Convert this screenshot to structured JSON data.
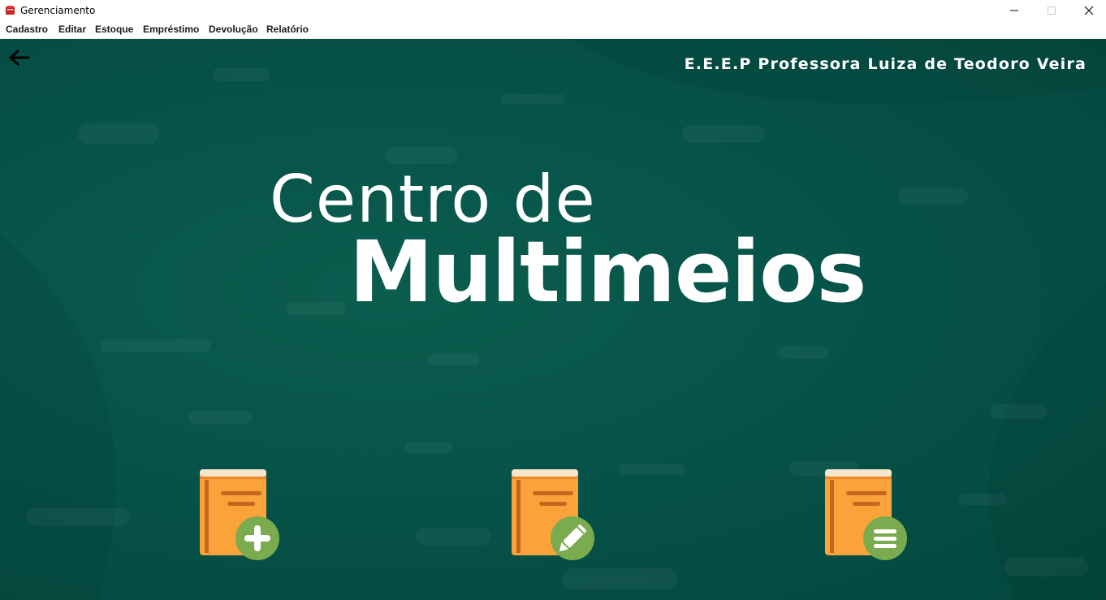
{
  "window": {
    "title": "Gerenciamento",
    "icon": "app-icon"
  },
  "menu": {
    "items": [
      {
        "label": "Cadastro"
      },
      {
        "label": "Editar"
      },
      {
        "label": "Estoque"
      },
      {
        "label": "Empréstimo"
      },
      {
        "label": "Devolução"
      },
      {
        "label": "Relatório"
      }
    ]
  },
  "header": {
    "school_name": "E.E.E.P Professora Luiza de Teodoro Veira"
  },
  "hero": {
    "line1": "Centro de",
    "line2": "Multimeios"
  },
  "actions": [
    {
      "name": "add-book",
      "icon": "book-add-icon"
    },
    {
      "name": "edit-book",
      "icon": "book-edit-icon"
    },
    {
      "name": "list-books",
      "icon": "book-list-icon"
    }
  ],
  "colors": {
    "background": "#06544a",
    "book_orange": "#f9a33a",
    "book_spine": "#e7872a",
    "badge_green": "#7aab4e",
    "text": "#ffffff"
  }
}
